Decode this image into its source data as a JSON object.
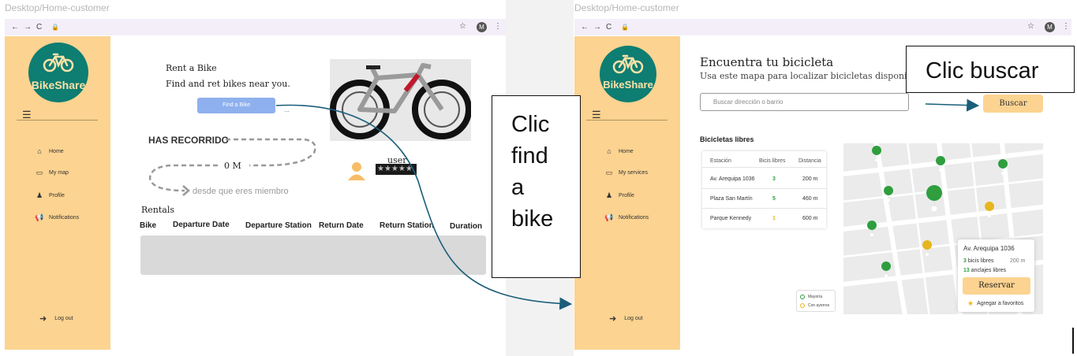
{
  "left_frame": {
    "title": "Desktop/Home-customer",
    "sidebar": {
      "logo_text": "BikeShare",
      "items": [
        {
          "label": "Home",
          "icon": "home-icon"
        },
        {
          "label": "My map",
          "icon": "folder-icon"
        },
        {
          "label": "Profile",
          "icon": "user-icon"
        },
        {
          "label": "Notifications",
          "icon": "megaphone-icon"
        }
      ],
      "logout": "Log out"
    },
    "rent_title": "Rent a Bike",
    "rent_subtitle": "Find and ret bikes near you.",
    "find_button": "Find a Bike",
    "dots": "...",
    "has_recorrido": "HAS RECORRIDO",
    "distance": "0 M",
    "desde": "desde que eres miembro",
    "user_label": "user",
    "rating": "★★★★★",
    "rentals": {
      "title": "Rentals",
      "columns": [
        "Bike",
        "Departure Date",
        "Departure Station",
        "Return Date",
        "Return Station",
        "Duration"
      ]
    }
  },
  "right_frame": {
    "title": "Desktop/Home-customer",
    "sidebar": {
      "logo_text": "BikeShare",
      "items": [
        {
          "label": "Home",
          "icon": "home-icon"
        },
        {
          "label": "My services",
          "icon": "folder-icon"
        },
        {
          "label": "Profile",
          "icon": "user-icon"
        },
        {
          "label": "Notifications",
          "icon": "megaphone-icon"
        }
      ],
      "logout": "Log out"
    },
    "heading": "Encuentra tu bicicleta",
    "subheading": "Usa este mapa para localizar bicicletas disponibles",
    "search_placeholder": "Buscar dirección o barrio",
    "search_button": "Buscar",
    "bicis_title": "Bicicletas libres",
    "table": {
      "headers": [
        "Estación",
        "Bicis libres",
        "Distancia"
      ],
      "rows": [
        {
          "station": "Av. Arequipa 1036",
          "bikes": "3",
          "distance": "200 m",
          "color": "#2e9e3e"
        },
        {
          "station": "Plaza San Martín",
          "bikes": "5",
          "distance": "460 m",
          "color": "#2e9e3e"
        },
        {
          "station": "Parque Kennedy",
          "bikes": "1",
          "distance": "600 m",
          "color": "#e7b51c"
        }
      ]
    },
    "popup": {
      "title": "Av. Arequipa 1036",
      "bikes_count": "3",
      "bikes_text": "bicis libres",
      "distance": "200 m",
      "docks_count": "13",
      "docks_text": "anclajes libres",
      "reserve": "Reservar",
      "favorite": "Agregar a favoritos"
    },
    "legend": {
      "more": "Mayoría",
      "few": "Con ayerres"
    }
  },
  "callouts": {
    "find": [
      "Clic",
      "find",
      "a",
      "bike"
    ],
    "buscar": "Clic buscar"
  },
  "colors": {
    "sidebar": "#fcd390",
    "logo": "#0e7d72",
    "button_blue": "#8fb0ee",
    "arrow": "#1a5e7a"
  }
}
